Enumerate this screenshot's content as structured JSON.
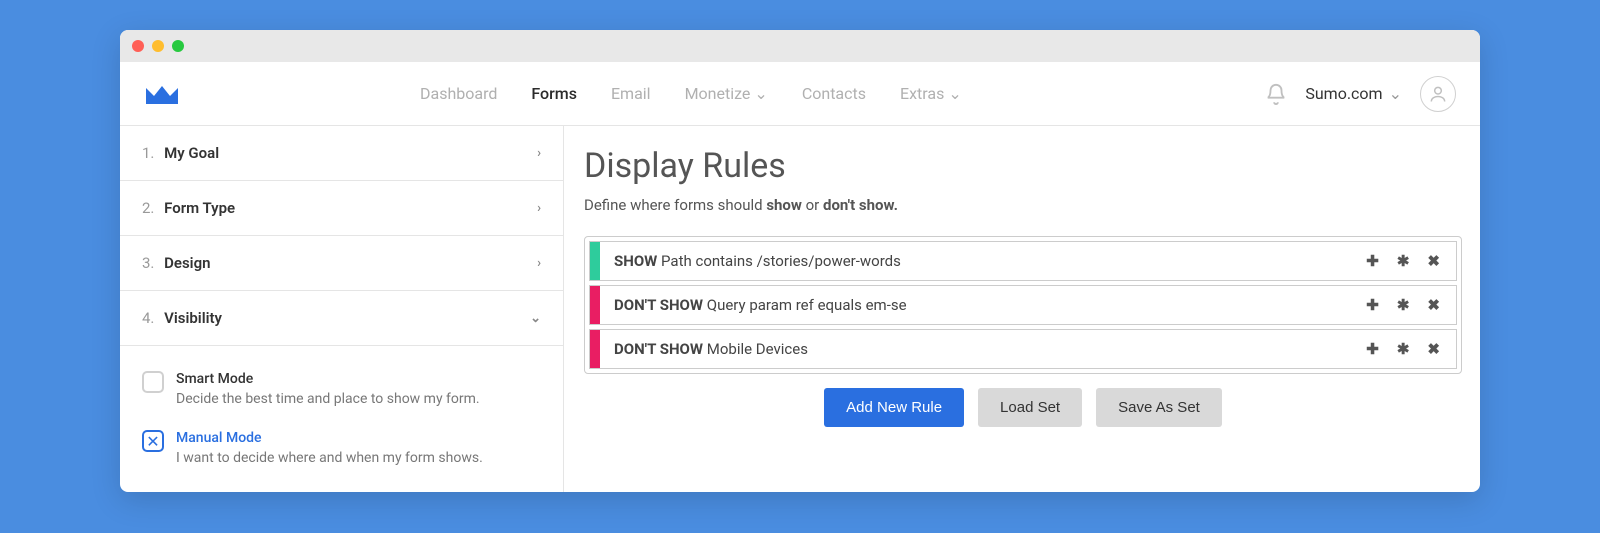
{
  "nav": {
    "items": [
      {
        "label": "Dashboard",
        "active": false,
        "dropdown": false
      },
      {
        "label": "Forms",
        "active": true,
        "dropdown": false
      },
      {
        "label": "Email",
        "active": false,
        "dropdown": false
      },
      {
        "label": "Monetize",
        "active": false,
        "dropdown": true
      },
      {
        "label": "Contacts",
        "active": false,
        "dropdown": false
      },
      {
        "label": "Extras",
        "active": false,
        "dropdown": true
      }
    ],
    "site_label": "Sumo.com"
  },
  "sidebar": {
    "steps": [
      {
        "num": "1.",
        "label": "My Goal",
        "open": false
      },
      {
        "num": "2.",
        "label": "Form Type",
        "open": false
      },
      {
        "num": "3.",
        "label": "Design",
        "open": false
      },
      {
        "num": "4.",
        "label": "Visibility",
        "open": true
      }
    ],
    "modes": [
      {
        "title": "Smart Mode",
        "desc": "Decide the best time and place to show my form.",
        "selected": false
      },
      {
        "title": "Manual Mode",
        "desc": "I want to decide where and when my form shows.",
        "selected": true
      }
    ]
  },
  "main": {
    "title": "Display Rules",
    "subtext_pre": "Define where forms should ",
    "subtext_em1": "show",
    "subtext_mid": " or ",
    "subtext_em2": "don't show.",
    "rules": [
      {
        "kind": "SHOW",
        "text": "Path contains /stories/power-words",
        "accent": "show"
      },
      {
        "kind": "DON'T SHOW",
        "text": "Query param ref equals em-se",
        "accent": "hide"
      },
      {
        "kind": "DON'T SHOW",
        "text": "Mobile Devices",
        "accent": "hide"
      }
    ],
    "buttons": {
      "add": "Add New Rule",
      "load": "Load Set",
      "save": "Save As Set"
    }
  }
}
